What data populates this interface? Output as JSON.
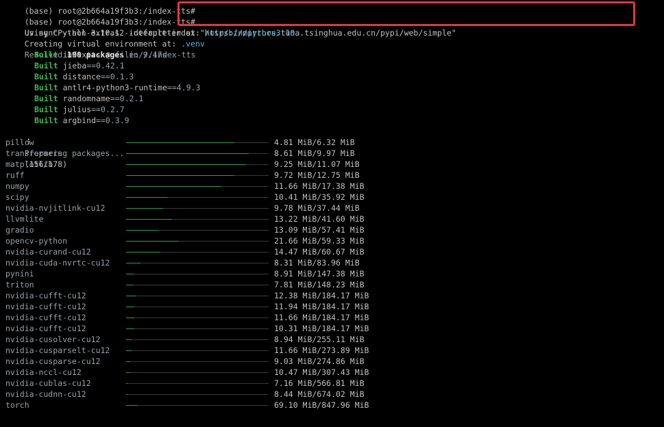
{
  "header_lines": [
    {
      "prompt": "(base) root@2b664a19f3b3:/index-tts#",
      "text": ""
    },
    {
      "prompt": "(base) root@2b664a19f3b3:/index-tts#",
      "text": "uv sync --all-extras --default-index \"https://mirrors.tuna.tsinghua.edu.cn/pypi/web/simple\""
    }
  ],
  "using_line": {
    "prefix": "Using CPython 3.10.12 interpreter at: ",
    "path": "/usr/bin/python3.10"
  },
  "creating_line": {
    "prefix": "Creating virtual environment at: ",
    "path": ".venv"
  },
  "resolved_line": {
    "prefix": "Resolved ",
    "count": "190 packages",
    "suffix": " in 9.47s"
  },
  "built": [
    {
      "label": "Built",
      "name": "indextts",
      "sep": " @ ",
      "version": "file:///index-tts"
    },
    {
      "label": "Built",
      "name": "jieba",
      "sep": "==",
      "version": "0.42.1"
    },
    {
      "label": "Built",
      "name": "distance",
      "sep": "==",
      "version": "0.1.3"
    },
    {
      "label": "Built",
      "name": "antlr4-python3-runtime",
      "sep": "==",
      "version": "4.9.3"
    },
    {
      "label": "Built",
      "name": "randomname",
      "sep": "==",
      "version": "0.2.1"
    },
    {
      "label": "Built",
      "name": "julius",
      "sep": "==",
      "version": "0.2.7"
    },
    {
      "label": "Built",
      "name": "argbind",
      "sep": "==",
      "version": "0.3.9"
    }
  ],
  "preparing": {
    "spinner": "⠸",
    "text": "Preparing packages...",
    "progress": "(156/178)"
  },
  "downloads": [
    {
      "name": "pillow",
      "size": "4.81 MiB/6.32 MiB",
      "progress": 0.76
    },
    {
      "name": "transformers",
      "size": "8.61 MiB/9.97 MiB",
      "progress": 0.86
    },
    {
      "name": "matplotlib",
      "size": "9.25 MiB/11.07 MiB",
      "progress": 0.84
    },
    {
      "name": "ruff",
      "size": "9.72 MiB/12.75 MiB",
      "progress": 0.76
    },
    {
      "name": "numpy",
      "size": "11.66 MiB/17.38 MiB",
      "progress": 0.67
    },
    {
      "name": "scipy",
      "size": "10.41 MiB/35.92 MiB",
      "progress": 0.29
    },
    {
      "name": "nvidia-nvjitlink-cu12",
      "size": "9.78 MiB/37.44 MiB",
      "progress": 0.26
    },
    {
      "name": "llvmlite",
      "size": "13.22 MiB/41.60 MiB",
      "progress": 0.32
    },
    {
      "name": "gradio",
      "size": "13.09 MiB/57.41 MiB",
      "progress": 0.23
    },
    {
      "name": "opencv-python",
      "size": "21.66 MiB/59.33 MiB",
      "progress": 0.37
    },
    {
      "name": "nvidia-curand-cu12",
      "size": "14.47 MiB/60.67 MiB",
      "progress": 0.24
    },
    {
      "name": "nvidia-cuda-nvrtc-cu12",
      "size": "8.31 MiB/83.96 MiB",
      "progress": 0.1
    },
    {
      "name": "pynini",
      "size": "8.91 MiB/147.38 MiB",
      "progress": 0.06
    },
    {
      "name": "triton",
      "size": "7.81 MiB/148.23 MiB",
      "progress": 0.05
    },
    {
      "name": "nvidia-cufft-cu12",
      "size": "12.38 MiB/184.17 MiB",
      "progress": 0.07
    },
    {
      "name": "nvidia-cufft-cu12",
      "size": "11.94 MiB/184.17 MiB",
      "progress": 0.06
    },
    {
      "name": "nvidia-cufft-cu12",
      "size": "11.66 MiB/184.17 MiB",
      "progress": 0.06
    },
    {
      "name": "nvidia-cufft-cu12",
      "size": "10.31 MiB/184.17 MiB",
      "progress": 0.06
    },
    {
      "name": "nvidia-cusolver-cu12",
      "size": "8.94 MiB/255.11 MiB",
      "progress": 0.04
    },
    {
      "name": "nvidia-cusparselt-cu12",
      "size": "11.66 MiB/273.89 MiB",
      "progress": 0.04
    },
    {
      "name": "nvidia-cusparse-cu12",
      "size": "9.03 MiB/274.86 MiB",
      "progress": 0.03
    },
    {
      "name": "nvidia-nccl-cu12",
      "size": "10.47 MiB/307.43 MiB",
      "progress": 0.03
    },
    {
      "name": "nvidia-cublas-cu12",
      "size": "7.16 MiB/566.81 MiB",
      "progress": 0.01
    },
    {
      "name": "nvidia-cudnn-cu12",
      "size": "8.44 MiB/674.02 MiB",
      "progress": 0.01
    },
    {
      "name": "torch",
      "size": "69.10 MiB/847.96 MiB",
      "progress": 0.08
    }
  ],
  "colors": {
    "highlight": "#e0383f",
    "built": "#3fb950",
    "path": "#5fb7d6",
    "bar_fill": "#2ea043"
  }
}
